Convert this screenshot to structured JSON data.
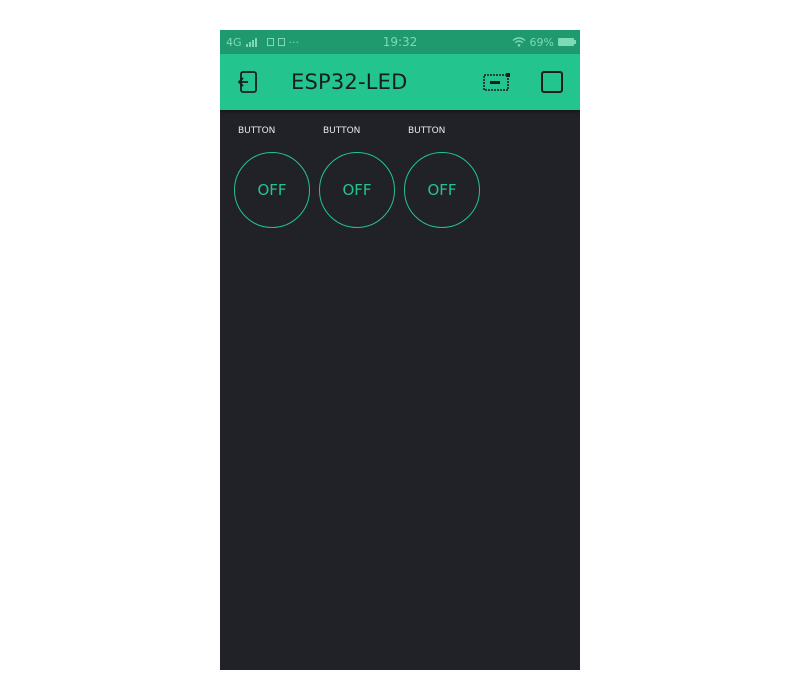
{
  "status_bar": {
    "network": "4G",
    "more": "···",
    "time": "19:32",
    "battery_text": "69%"
  },
  "app_bar": {
    "title": "ESP32-LED",
    "icons": [
      "back-icon",
      "device-icon",
      "play-icon"
    ]
  },
  "widgets": [
    {
      "label": "BUTTON",
      "state": "OFF"
    },
    {
      "label": "BUTTON",
      "state": "OFF"
    },
    {
      "label": "BUTTON",
      "state": "OFF"
    }
  ],
  "colors": {
    "accent": "#23c48e",
    "background": "#212227",
    "status_bar": "#1f9a6f",
    "title_text": "#1a1d22"
  }
}
